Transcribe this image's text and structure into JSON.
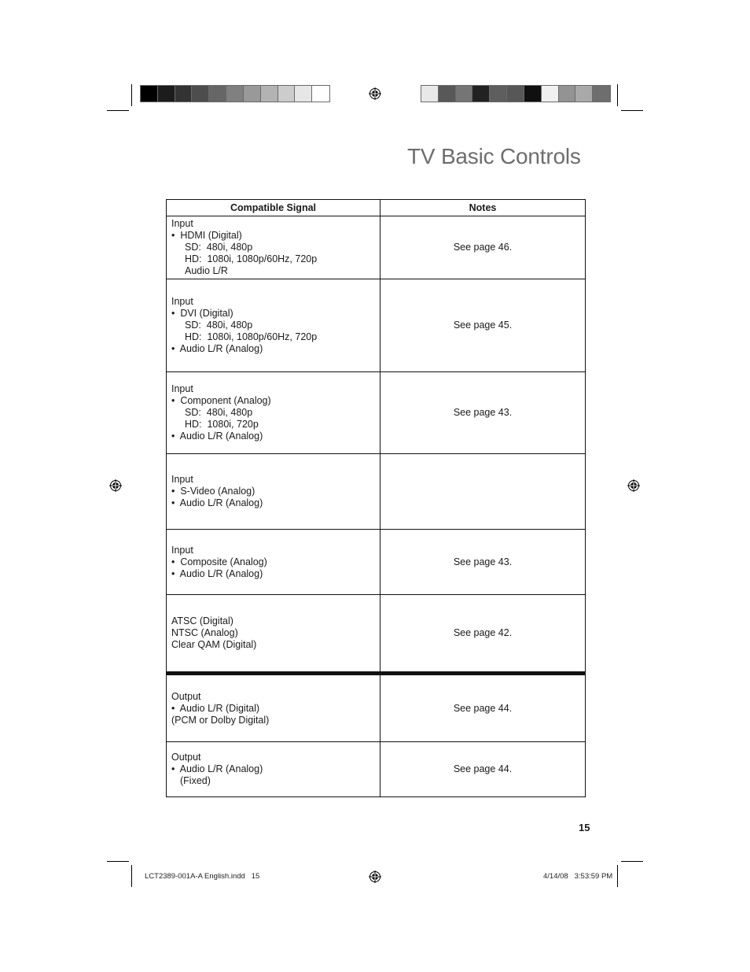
{
  "page": {
    "title": "TV Basic Controls",
    "page_number": "15"
  },
  "color_bars": {
    "left": [
      "#000000",
      "#1c1c1c",
      "#333333",
      "#4d4d4d",
      "#666666",
      "#808080",
      "#999999",
      "#b3b3b3",
      "#cccccc",
      "#e6e6e6",
      "#ffffff"
    ],
    "right": [
      "#e8e8e8",
      "#585858",
      "#757575",
      "#222222",
      "#5e5e5e",
      "#575757",
      "#101010",
      "#f0f0f0",
      "#939393",
      "#a9a9a9",
      "#6e6e6e"
    ]
  },
  "table": {
    "headers": [
      "Compatible Signal",
      "Notes"
    ],
    "rows": [
      {
        "signal": [
          {
            "text": "Input",
            "indent": 0
          },
          {
            "text": "•  HDMI (Digital)",
            "indent": 0
          },
          {
            "text": "SD:  480i, 480p",
            "indent": 2
          },
          {
            "text": "HD:  1080i, 1080p/60Hz, 720p",
            "indent": 2
          },
          {
            "text": "Audio L/R",
            "indent": 2
          }
        ],
        "notes": "See page 46."
      },
      {
        "signal": [
          {
            "text": "Input",
            "indent": 0
          },
          {
            "text": "•  DVI (Digital)",
            "indent": 0
          },
          {
            "text": "SD:  480i, 480p",
            "indent": 2
          },
          {
            "text": "HD:  1080i, 1080p/60Hz, 720p",
            "indent": 2
          },
          {
            "text": "•  Audio L/R (Analog)",
            "indent": 0
          }
        ],
        "notes": "See page 45."
      },
      {
        "signal": [
          {
            "text": "Input",
            "indent": 0
          },
          {
            "text": "•  Component (Analog)",
            "indent": 0
          },
          {
            "text": "SD:  480i, 480p",
            "indent": 2
          },
          {
            "text": "HD:  1080i, 720p",
            "indent": 2
          },
          {
            "text": "•  Audio L/R (Analog)",
            "indent": 0
          }
        ],
        "notes": "See page 43."
      },
      {
        "signal": [
          {
            "text": "Input",
            "indent": 0
          },
          {
            "text": "•  S-Video (Analog)",
            "indent": 0
          },
          {
            "text": "•  Audio L/R (Analog)",
            "indent": 0
          }
        ],
        "notes": ""
      },
      {
        "signal": [
          {
            "text": "Input",
            "indent": 0
          },
          {
            "text": "•  Composite (Analog)",
            "indent": 0
          },
          {
            "text": "•  Audio L/R (Analog)",
            "indent": 0
          }
        ],
        "notes": "See page 43."
      },
      {
        "signal": [
          {
            "text": "ATSC (Digital)",
            "indent": 0
          },
          {
            "text": "NTSC (Analog)",
            "indent": 0
          },
          {
            "text": "Clear QAM (Digital)",
            "indent": 0
          }
        ],
        "notes": "See page 42."
      },
      {
        "signal": [
          {
            "text": "Output",
            "indent": 0
          },
          {
            "text": "•  Audio L/R (Digital)",
            "indent": 0
          },
          {
            "text": "(PCM or Dolby Digital)",
            "indent": 0
          }
        ],
        "notes": "See page 44."
      },
      {
        "signal": [
          {
            "text": "Output",
            "indent": 0
          },
          {
            "text": "•  Audio L/R (Analog)",
            "indent": 0
          },
          {
            "text": "(Fixed)",
            "indent": 1
          }
        ],
        "notes": "See page 44."
      }
    ]
  },
  "footer": {
    "file": "LCT2389-001A-A English.indd   15",
    "timestamp": "4/14/08   3:53:59 PM"
  },
  "icons": {
    "registration_mark": "registration-target-icon"
  }
}
